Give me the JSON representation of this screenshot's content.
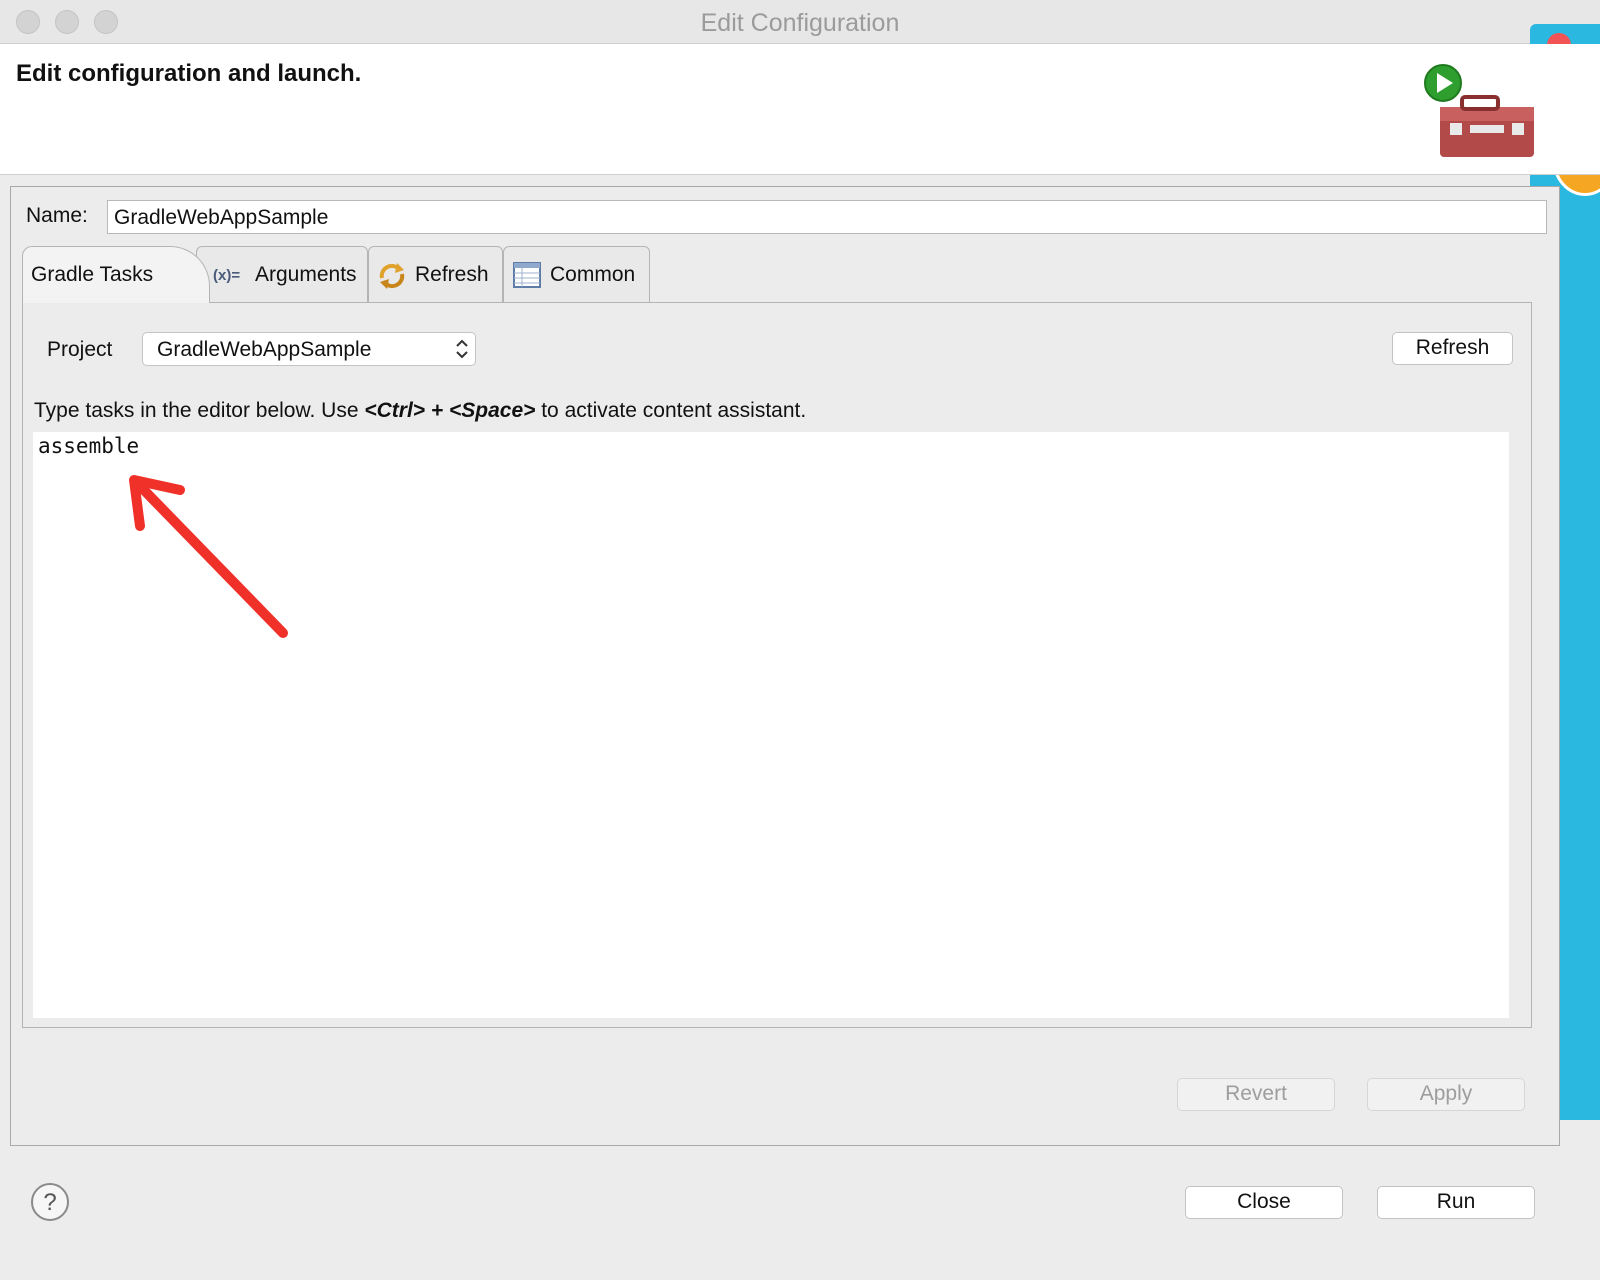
{
  "window": {
    "title": "Edit Configuration"
  },
  "header": {
    "title": "Edit configuration and launch.",
    "icon": "launch-toolbox-icon"
  },
  "name_field": {
    "label": "Name:",
    "value": "GradleWebAppSample"
  },
  "tabs": [
    {
      "label": "Gradle Tasks",
      "active": true
    },
    {
      "label": "Arguments",
      "icon": "arguments-icon"
    },
    {
      "label": "Refresh",
      "icon": "refresh-icon"
    },
    {
      "label": "Common",
      "icon": "common-table-icon"
    }
  ],
  "gradle_tasks": {
    "project_label": "Project",
    "project_value": "GradleWebAppSample",
    "refresh_button": "Refresh",
    "hint_prefix": "Type tasks in the editor below. Use ",
    "hint_ctrl": "<Ctrl>",
    "hint_plus": " + ",
    "hint_space": "<Space>",
    "hint_suffix": " to activate content assistant.",
    "editor_text": "assemble"
  },
  "actions": {
    "revert": "Revert",
    "apply": "Apply"
  },
  "footer": {
    "close": "Close",
    "run": "Run",
    "help_icon": "help-icon"
  },
  "colors": {
    "accent_panel": "#2bb8e0",
    "annotation_arrow": "#f0312a"
  }
}
